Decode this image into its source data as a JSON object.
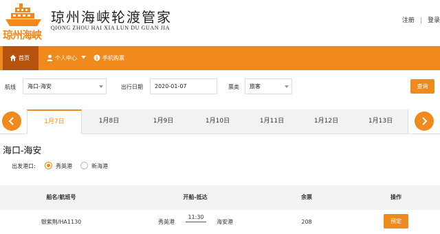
{
  "brand": {
    "logo_text": "琼州海峡",
    "title": "琼州海峡轮渡管家",
    "subtitle": "QIONG ZHOU HAI XIA LUN DU GUAN JIA",
    "accent_color": "#f08a1c",
    "dark_accent_color": "#b5530e"
  },
  "top_links": {
    "register": "注册",
    "separator": "|",
    "login": "登录"
  },
  "nav": {
    "items": [
      {
        "label": "首页",
        "icon": "home-icon",
        "active": true
      },
      {
        "label": "个人中心",
        "icon": "user-icon",
        "active": false
      },
      {
        "label": "手机购票",
        "icon": "info-icon",
        "active": false
      }
    ]
  },
  "search": {
    "route_label": "航线",
    "route_value": "海口-海安",
    "date_label": "出行日期",
    "date_value": "2020-01-07",
    "ticket_label": "票类",
    "ticket_value": "旅客",
    "query_button": "查询"
  },
  "dates": {
    "tabs": [
      "1月7日",
      "1月8日",
      "1月9日",
      "1月10日",
      "1月11日",
      "1月12日",
      "1月13日"
    ],
    "active_index": 0
  },
  "route": {
    "title": "海口-海安",
    "port_label": "出发港口:",
    "ports": [
      {
        "label": "秀英港",
        "selected": true
      },
      {
        "label": "新海港",
        "selected": false
      }
    ]
  },
  "table": {
    "headers": [
      "船名/航班号",
      "开船-抵达",
      "余票",
      "操作"
    ],
    "rows": [
      {
        "ship": "银紫荆/HA1130",
        "from": "秀英港",
        "time": "11:30",
        "to": "海安港",
        "remaining": "208",
        "action": "预定"
      }
    ]
  }
}
